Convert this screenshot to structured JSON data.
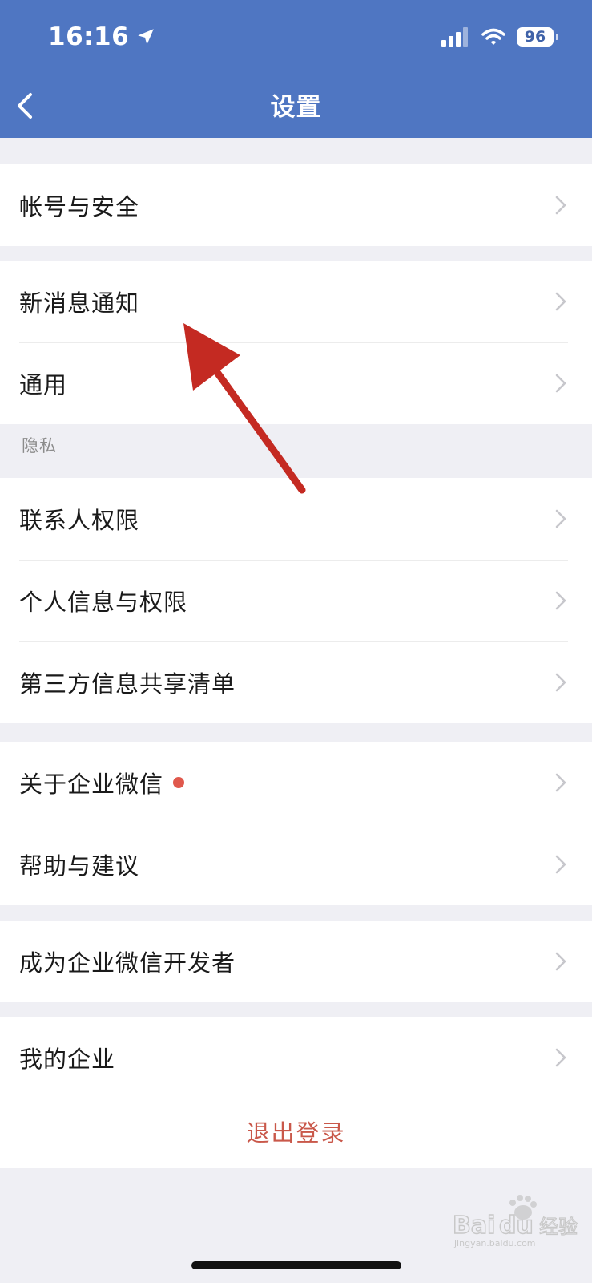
{
  "status_bar": {
    "time": "16:16",
    "battery": "96"
  },
  "nav": {
    "title": "设置"
  },
  "groups": [
    {
      "items": [
        {
          "label": "帐号与安全"
        }
      ]
    },
    {
      "items": [
        {
          "label": "新消息通知"
        },
        {
          "label": "通用"
        }
      ]
    },
    {
      "section_title": "隐私",
      "items": [
        {
          "label": "联系人权限"
        },
        {
          "label": "个人信息与权限"
        },
        {
          "label": "第三方信息共享清单"
        }
      ]
    },
    {
      "items": [
        {
          "label": "关于企业微信",
          "badge_dot": true
        },
        {
          "label": "帮助与建议"
        }
      ]
    },
    {
      "items": [
        {
          "label": "成为企业微信开发者"
        }
      ]
    },
    {
      "items": [
        {
          "label": "我的企业"
        }
      ]
    }
  ],
  "logout": {
    "label": "退出登录"
  },
  "colors": {
    "header": "#4f76c2",
    "logout_text": "#c9584a",
    "badge_dot": "#e0584c",
    "annotation_arrow": "#c42a22"
  }
}
